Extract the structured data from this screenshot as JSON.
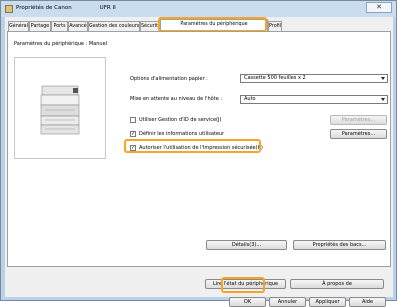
{
  "window": {
    "title": "Propriétés de Canon                UFR II",
    "close_glyph": "✕"
  },
  "tabs": [
    "Général",
    "Partage",
    "Ports",
    "Avancé",
    "Gestion des couleurs",
    "Sécurité",
    "Paramètres du périphérique",
    "Profil"
  ],
  "panel": {
    "header": "Paramètres du périphérique : Manuel",
    "paper_source_label": "Options d'alimentation papier :",
    "paper_source_value": "Cassette 500 feuilles x 2",
    "standby_label": "Mise en attente au niveau de l'hôte :",
    "standby_value": "Auto",
    "dept_id_label": "Utiliser Gestion d'ID de service(J)",
    "dept_id_settings": "Paramètres...",
    "user_info_label": "Définir les informations utilisateur",
    "user_info_settings": "Paramètres...",
    "secure_print_label": "Autoriser l'utilisation de l'Impression sécurisée(K)",
    "details_button": "Détails(3)...",
    "cassette_props_button": "Propriétés des bacs...",
    "read_device_button": "Lire l'état du périphérique",
    "about_button": "À propos de"
  },
  "footer": {
    "ok": "OK",
    "cancel": "Annuler",
    "apply": "Appliquer",
    "help": "Aide"
  },
  "checks": {
    "dept_id": false,
    "user_info": true,
    "secure_print": true
  },
  "check_glyph": "✓"
}
